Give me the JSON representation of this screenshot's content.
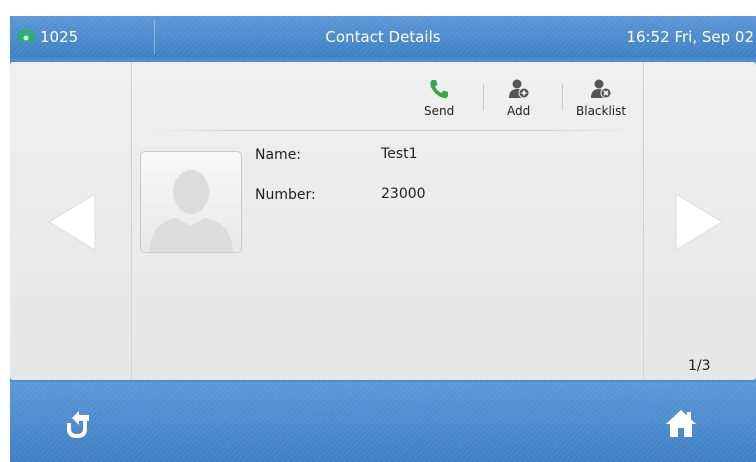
{
  "status_bar": {
    "account": "1025",
    "title": "Contact Details",
    "clock": "16:52 Fri, Sep 02"
  },
  "toolbar": {
    "send_label": "Send",
    "add_label": "Add",
    "blacklist_label": "Blacklist"
  },
  "contact": {
    "name_label": "Name:",
    "name_value": "Test1",
    "number_label": "Number:",
    "number_value": "23000"
  },
  "pagination": {
    "indicator": "1/3"
  },
  "icons": {
    "account": "phone-handset-icon",
    "send": "phone-call-icon",
    "add": "add-contact-icon",
    "blacklist": "blacklist-contact-icon",
    "avatar": "person-silhouette-icon",
    "prev": "left-arrow-icon",
    "next": "right-arrow-icon",
    "back": "back-icon",
    "home": "home-icon"
  },
  "colors": {
    "bar_blue": "#4b8bcd",
    "send_green": "#3aa544",
    "account_icon_green": "#27b26a",
    "panel_gray": "#ececec"
  }
}
